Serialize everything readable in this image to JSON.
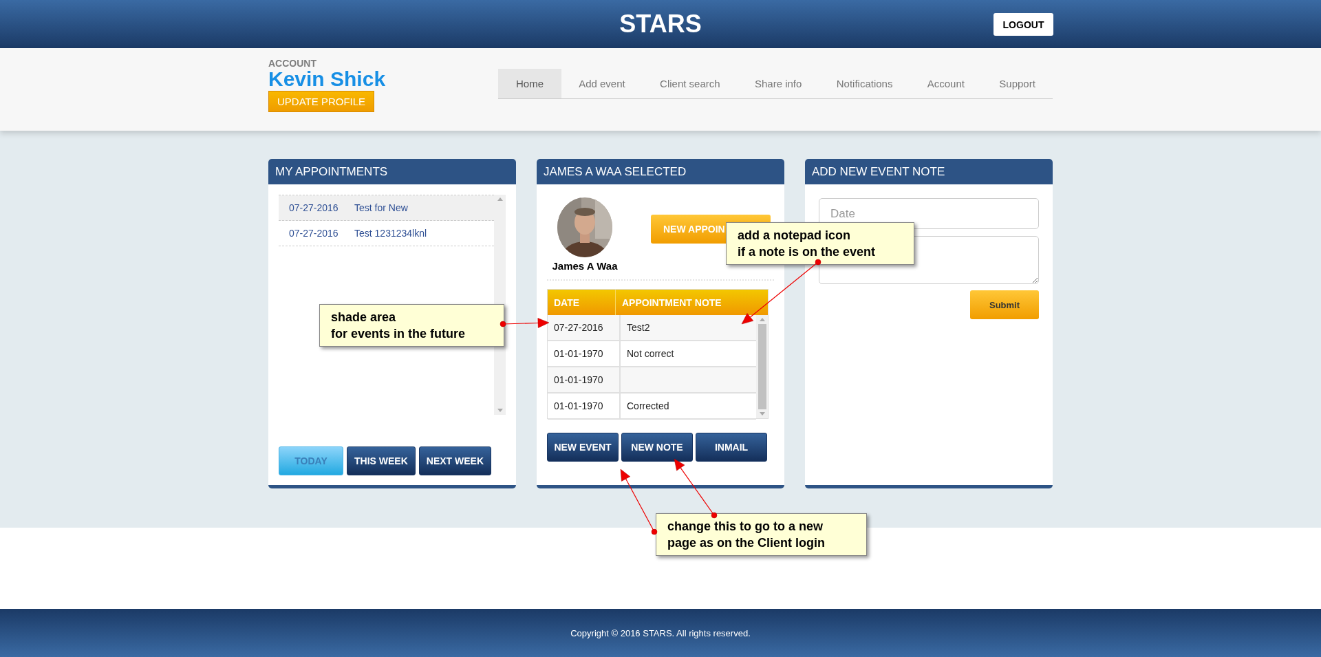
{
  "header": {
    "title": "STARS",
    "logout": "LOGOUT"
  },
  "account": {
    "label": "ACCOUNT",
    "name": "Kevin Shick",
    "update_button": "UPDATE PROFILE"
  },
  "nav": [
    {
      "label": "Home",
      "selected": true
    },
    {
      "label": "Add event",
      "selected": false
    },
    {
      "label": "Client search",
      "selected": false
    },
    {
      "label": "Share info",
      "selected": false
    },
    {
      "label": "Notifications",
      "selected": false
    },
    {
      "label": "Account",
      "selected": false
    },
    {
      "label": "Support",
      "selected": false
    }
  ],
  "appointments": {
    "title": "MY APPOINTMENTS",
    "rows": [
      {
        "date": "07-27-2016",
        "title": "Test for New",
        "selected": true
      },
      {
        "date": "07-27-2016",
        "title": "Test 1231234lknl",
        "selected": false
      }
    ],
    "buttons": [
      {
        "label": "TODAY",
        "selected": true
      },
      {
        "label": "THIS WEEK",
        "selected": false
      },
      {
        "label": "NEXT WEEK",
        "selected": false
      }
    ]
  },
  "client": {
    "title": "JAMES A WAA SELECTED",
    "name": "James A Waa",
    "new_appointment": "NEW APPOIN",
    "table": {
      "columns": [
        "DATE",
        "APPOINTMENT NOTE"
      ],
      "rows": [
        {
          "date": "07-27-2016",
          "note": "Test2"
        },
        {
          "date": "01-01-1970",
          "note": "Not correct"
        },
        {
          "date": "01-01-1970"
        },
        {
          "date": "01-01-1970",
          "note": "Corrected"
        }
      ]
    },
    "buttons": [
      "NEW EVENT",
      "NEW NOTE",
      "INMAIL"
    ]
  },
  "event_note": {
    "title": "ADD NEW EVENT NOTE",
    "date_placeholder": "Date",
    "submit": "Submit"
  },
  "footer": "Copyright © 2016 STARS. All rights reserved.",
  "annotations": [
    {
      "text": "shade area\nfor events in the future"
    },
    {
      "text": "add a notepad icon\nif a note is on the event"
    },
    {
      "text": "change this to go to a new\npage as on the Client login"
    }
  ]
}
